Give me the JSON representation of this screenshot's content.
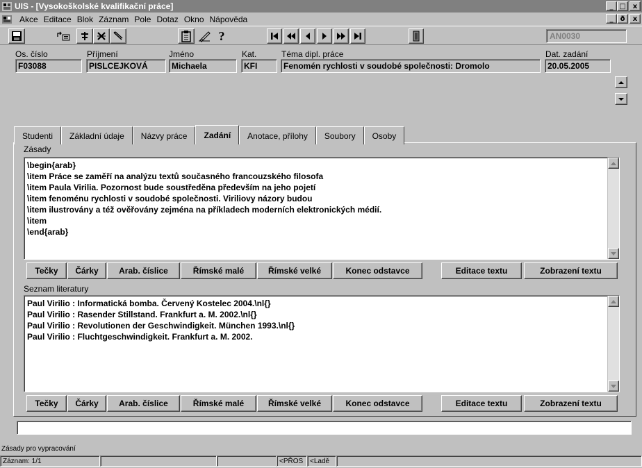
{
  "window": {
    "title": "UIS - [Vysokoškolské kvalifikační práce]",
    "controls": [
      "_",
      "□",
      "x"
    ]
  },
  "menu": {
    "items": [
      "Akce",
      "Editace",
      "Blok",
      "Záznam",
      "Pole",
      "Dotaz",
      "Okno",
      "Nápověda"
    ],
    "mdi_controls": [
      "_",
      "ð",
      "x"
    ]
  },
  "toolbar": {
    "record_id": "AN0030",
    "icons": [
      "save-icon",
      "list-icon",
      "insert-record-icon",
      "delete-record-icon",
      "edit-icon",
      "clipboard-icon",
      "pen-icon",
      "help-icon",
      "first-record-icon",
      "prev-block-icon",
      "prev-record-icon",
      "next-record-icon",
      "next-block-icon",
      "last-record-icon",
      "exit-door-icon"
    ],
    "help_glyph": "?"
  },
  "header": {
    "labels": {
      "os_cislo": "Os. číslo",
      "prijmeni": "Příjmení",
      "jmeno": "Jméno",
      "kat": "Kat.",
      "tema": "Téma dipl. práce",
      "dat_zadani": "Dat. zadání"
    },
    "values": {
      "os_cislo": "F03088",
      "prijmeni": "PISLCEJKOVÁ",
      "jmeno": "Michaela",
      "kat": "KFI",
      "tema": "Fenomén rychlosti v soudobé společnosti: Dromolo",
      "dat_zadani": "20.05.2005"
    }
  },
  "tabs": [
    {
      "label": "Studenti",
      "active": false
    },
    {
      "label": "Základní údaje",
      "active": false
    },
    {
      "label": "Názvy práce",
      "active": false
    },
    {
      "label": "Zadání",
      "active": true
    },
    {
      "label": "Anotace, přílohy",
      "active": false
    },
    {
      "label": "Soubory",
      "active": false
    },
    {
      "label": "Osoby",
      "active": false
    }
  ],
  "zasady": {
    "label": "Zásady",
    "lines": [
      "\\begin{arab}",
      "\\item Práce se zaměří na analýzu textů současného francouzského filosofa",
      "\\item Paula Virilia. Pozornost bude soustředěna především na jeho pojetí",
      "\\item fenoménu rychlosti v soudobé společnosti. Viriliovy názory budou",
      "\\item ilustrovány a též ověřovány zejména na příkladech moderních elektronických médií.",
      "\\item",
      "\\end{arab}"
    ]
  },
  "literatura": {
    "label": "Seznam literatury",
    "lines": [
      "Paul Virilio : Informatická bomba. Červený Kostelec 2004.\\nl{}",
      "Paul Virilio : Rasender Stillstand. Frankfurt a. M. 2002.\\nl{}",
      "Paul Virilio : Revolutionen der Geschwindigkeit. München 1993.\\nl{}",
      "Paul Virilio : Fluchtgeschwindigkeit. Frankfurt a. M. 2002."
    ]
  },
  "format_buttons": {
    "tecky": "Tečky",
    "carky": "Čárky",
    "arab": "Arab. číslice",
    "rimske_male": "Římské malé",
    "rimske_velke": "Římské velké",
    "konec": "Konec odstavce",
    "editace": "Editace textu",
    "zobrazeni": "Zobrazení textu"
  },
  "status": {
    "hint": "Zásady pro vypracování",
    "record": "Záznam: 1/1",
    "mode1": "<PŘOS",
    "mode2": "<Ladě"
  }
}
